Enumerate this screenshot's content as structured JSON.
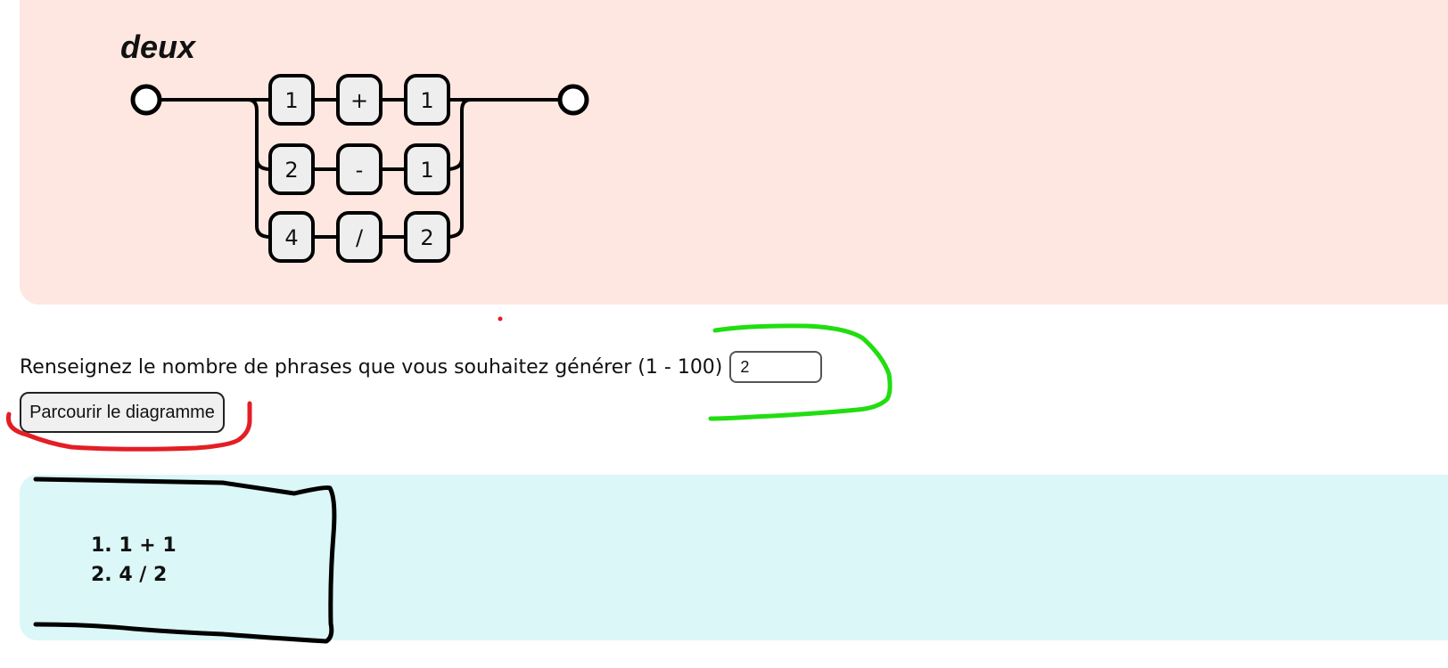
{
  "diagram": {
    "title": "deux",
    "branches": [
      [
        "1",
        "+",
        "1"
      ],
      [
        "2",
        "-",
        "1"
      ],
      [
        "4",
        "/",
        "2"
      ]
    ],
    "box_fill": "#eeeeee",
    "panel_color": "#fde7e0"
  },
  "form": {
    "prompt": "Renseignez le nombre de phrases que vous souhaitez générer (1 - 100)",
    "count_value": "2",
    "button_label": "Parcourir le diagramme"
  },
  "results": {
    "panel_color": "#dbf7f8",
    "items": [
      {
        "number": "1.",
        "text": "1 + 1"
      },
      {
        "number": "2.",
        "text": "4 / 2"
      }
    ]
  },
  "annotations": {
    "red_color": "#e31e24",
    "green_color": "#22dd11",
    "black_color": "#000000"
  }
}
